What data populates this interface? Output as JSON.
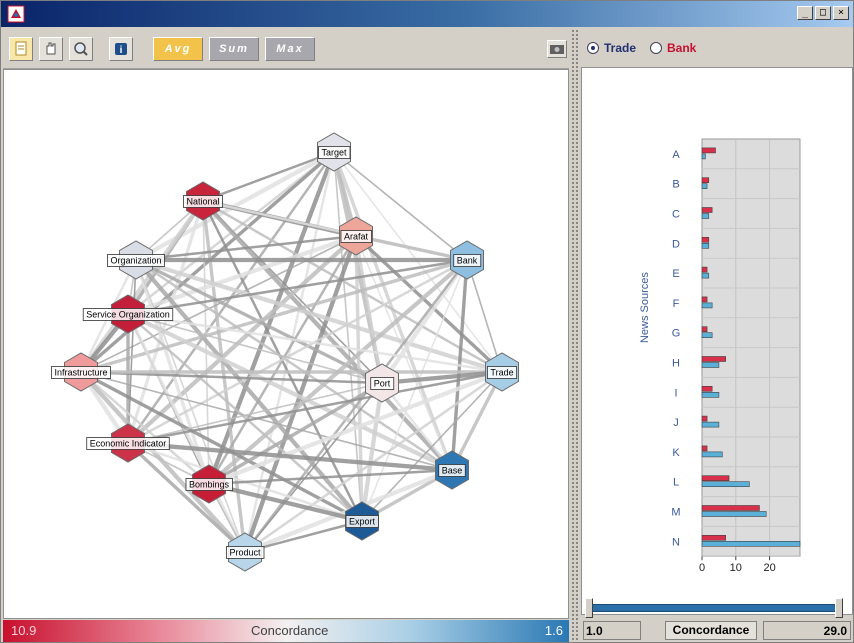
{
  "toolbar": {
    "avg_label": "Avg",
    "sum_label": "Sum",
    "max_label": "Max"
  },
  "graph": {
    "nodes": [
      {
        "label": "Target",
        "color": "#e2e2ea"
      },
      {
        "label": "National",
        "color": "#c8243c"
      },
      {
        "label": "Arafat",
        "color": "#eea59a"
      },
      {
        "label": "Organization",
        "color": "#d8dde6"
      },
      {
        "label": "Bank",
        "color": "#8fbfe0"
      },
      {
        "label": "Service Organization",
        "color": "#c31e3a"
      },
      {
        "label": "Infrastructure",
        "color": "#ef9b9b"
      },
      {
        "label": "Port",
        "color": "#f2e6e6"
      },
      {
        "label": "Trade",
        "color": "#a6cde6"
      },
      {
        "label": "Economic Indicator",
        "color": "#cc3348"
      },
      {
        "label": "Base",
        "color": "#2f77b3"
      },
      {
        "label": "Bombings",
        "color": "#c61e36"
      },
      {
        "label": "Export",
        "color": "#1e5a96"
      },
      {
        "label": "Product",
        "color": "#b8d6ea"
      }
    ]
  },
  "legend": {
    "min_label": "10.9",
    "title": "Concordance",
    "max_label": "1.6"
  },
  "radios": {
    "trade_label": "Trade",
    "bank_label": "Bank",
    "trade_color": "#203070",
    "bank_color": "#c8102e"
  },
  "chart_data": {
    "type": "bar",
    "orientation": "horizontal",
    "ylabel": "News Sources",
    "categories": [
      "A",
      "B",
      "C",
      "D",
      "E",
      "F",
      "G",
      "H",
      "I",
      "J",
      "K",
      "L",
      "M",
      "N"
    ],
    "series": [
      {
        "name": "Bank",
        "color": "#d8304a",
        "values": [
          4,
          2,
          3,
          2,
          1.5,
          1.5,
          1.5,
          7,
          3,
          1.5,
          1.5,
          8,
          17,
          7
        ]
      },
      {
        "name": "Trade",
        "color": "#5ab0d8",
        "values": [
          1,
          1.5,
          2,
          2,
          2,
          3,
          3,
          5,
          5,
          5,
          6,
          14,
          19,
          29
        ]
      }
    ],
    "xticks": [
      "0",
      "10",
      "20"
    ],
    "xlim": [
      0,
      29
    ]
  },
  "right_footer": {
    "min_value": "1.0",
    "label": "Concordance",
    "max_value": "29.0"
  }
}
